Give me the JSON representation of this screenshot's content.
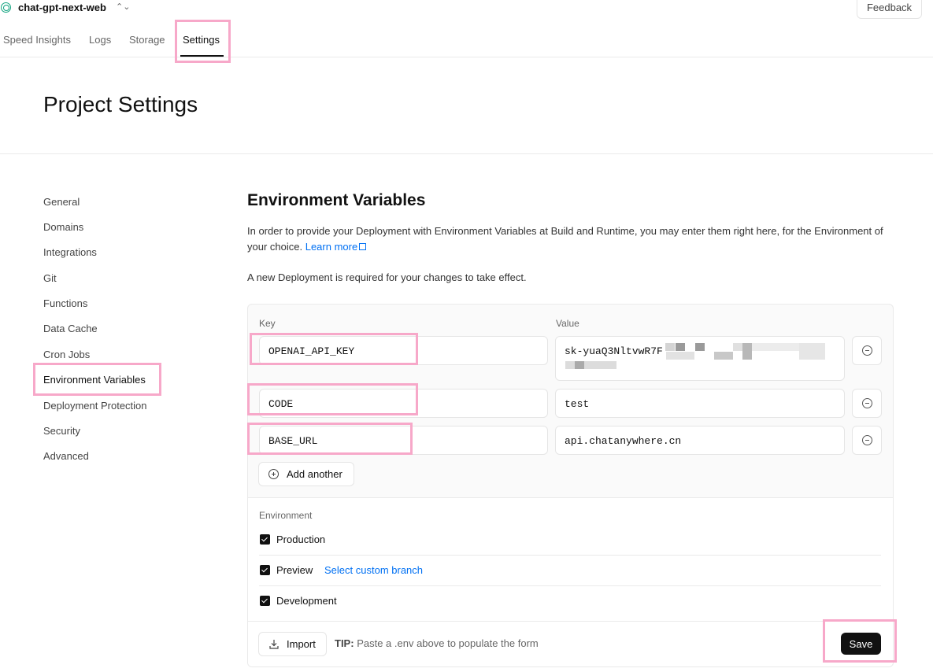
{
  "project": {
    "name": "chat-gpt-next-web",
    "switch_glyph": "⌃⌄"
  },
  "feedback_label": "Feedback",
  "tabs": [
    {
      "label": "Speed Insights"
    },
    {
      "label": "Logs"
    },
    {
      "label": "Storage"
    },
    {
      "label": "Settings",
      "active": true
    }
  ],
  "page_title": "Project Settings",
  "sidebar": {
    "items": [
      {
        "label": "General"
      },
      {
        "label": "Domains"
      },
      {
        "label": "Integrations"
      },
      {
        "label": "Git"
      },
      {
        "label": "Functions"
      },
      {
        "label": "Data Cache"
      },
      {
        "label": "Cron Jobs"
      },
      {
        "label": "Environment Variables",
        "active": true
      },
      {
        "label": "Deployment Protection"
      },
      {
        "label": "Security"
      },
      {
        "label": "Advanced"
      }
    ]
  },
  "env": {
    "title": "Environment Variables",
    "description": "In order to provide your Deployment with Environment Variables at Build and Runtime, you may enter them right here, for the Environment of your choice.",
    "learn_more": "Learn more",
    "note": "A new Deployment is required for your changes to take effect.",
    "key_header": "Key",
    "value_header": "Value",
    "rows": [
      {
        "key": "OPENAI_API_KEY",
        "value": "sk-yuaQ3NltvwR7F"
      },
      {
        "key": "CODE",
        "value": "test"
      },
      {
        "key": "BASE_URL",
        "value": "api.chatanywhere.cn"
      }
    ],
    "add_another": "Add another",
    "environment_label": "Environment",
    "environments": [
      {
        "label": "Production",
        "checked": true
      },
      {
        "label": "Preview",
        "checked": true,
        "link": "Select custom branch"
      },
      {
        "label": "Development",
        "checked": true
      }
    ],
    "import_label": "Import",
    "tip_label": "TIP:",
    "tip_text": "Paste a .env above to populate the form",
    "save_label": "Save"
  },
  "colors": {
    "accent": "#0070f3",
    "highlight": "#f7a8c9",
    "primary_button": "#111111"
  }
}
